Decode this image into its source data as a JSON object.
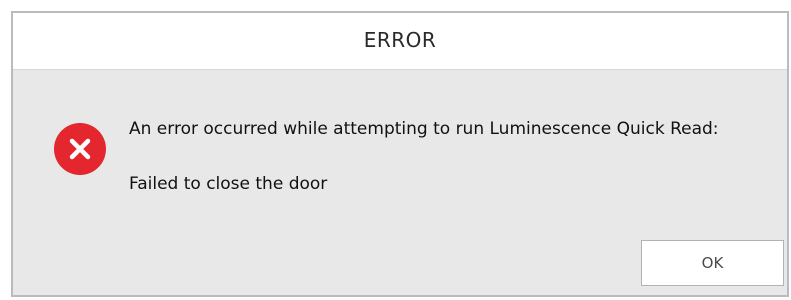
{
  "dialog": {
    "title": "ERROR",
    "icon": "error-icon",
    "message": "An error occurred while attempting to run Luminescence Quick Read:",
    "detail": "Failed to close the door",
    "ok_label": "OK"
  },
  "colors": {
    "error_red": "#e4262e",
    "background": "#e8e8e8",
    "titlebar": "#ffffff"
  }
}
